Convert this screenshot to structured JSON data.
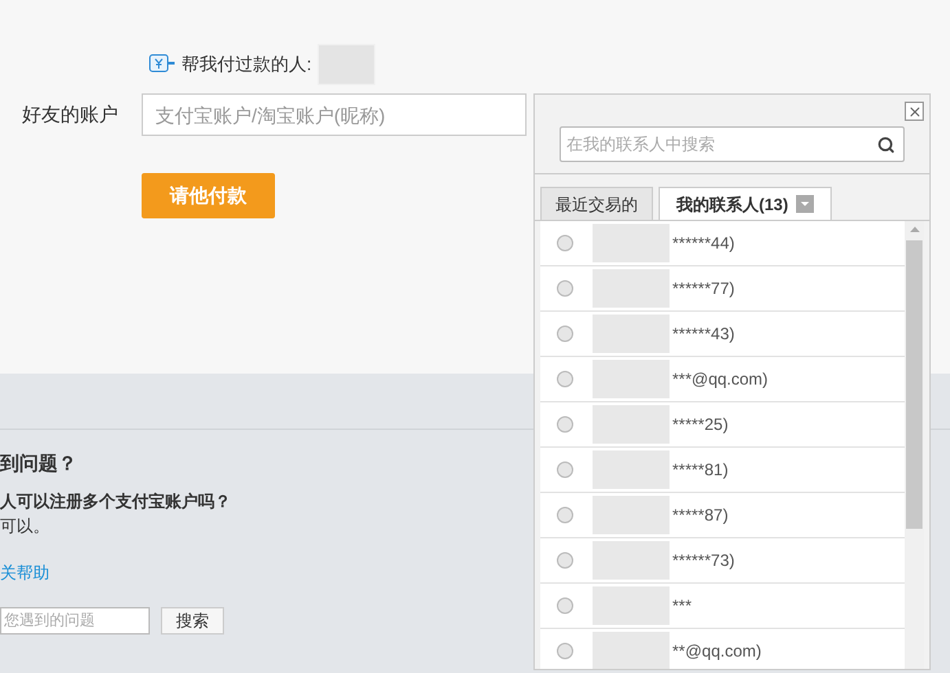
{
  "payers": {
    "label": "帮我付过款的人:"
  },
  "account": {
    "label": "好友的账户",
    "placeholder": "支付宝账户/淘宝账户(昵称)"
  },
  "request_button": "请他付款",
  "help": {
    "title": "到问题？",
    "question": "人可以注册多个支付宝账户吗？",
    "answer": "可以。",
    "link": "关帮助",
    "search_placeholder": "您遇到的问题",
    "search_button": "搜索"
  },
  "contacts_popup": {
    "search_placeholder": "在我的联系人中搜索",
    "tabs": [
      {
        "label": "最近交易的",
        "selected": false
      },
      {
        "label": "我的联系人(13)",
        "selected": true
      }
    ],
    "rows": [
      {
        "text": "******44)",
        "selected": false
      },
      {
        "text": "******77)",
        "selected": false
      },
      {
        "text": "******43)",
        "selected": false
      },
      {
        "text": "***@qq.com)",
        "selected": false
      },
      {
        "text": "*****25)",
        "selected": false
      },
      {
        "text": "*****81)",
        "selected": false
      },
      {
        "text": "*****87)",
        "selected": false
      },
      {
        "text": "******73)",
        "selected": false
      },
      {
        "text": "***",
        "selected": false
      },
      {
        "text": "**@qq.com)",
        "selected": false
      }
    ]
  }
}
